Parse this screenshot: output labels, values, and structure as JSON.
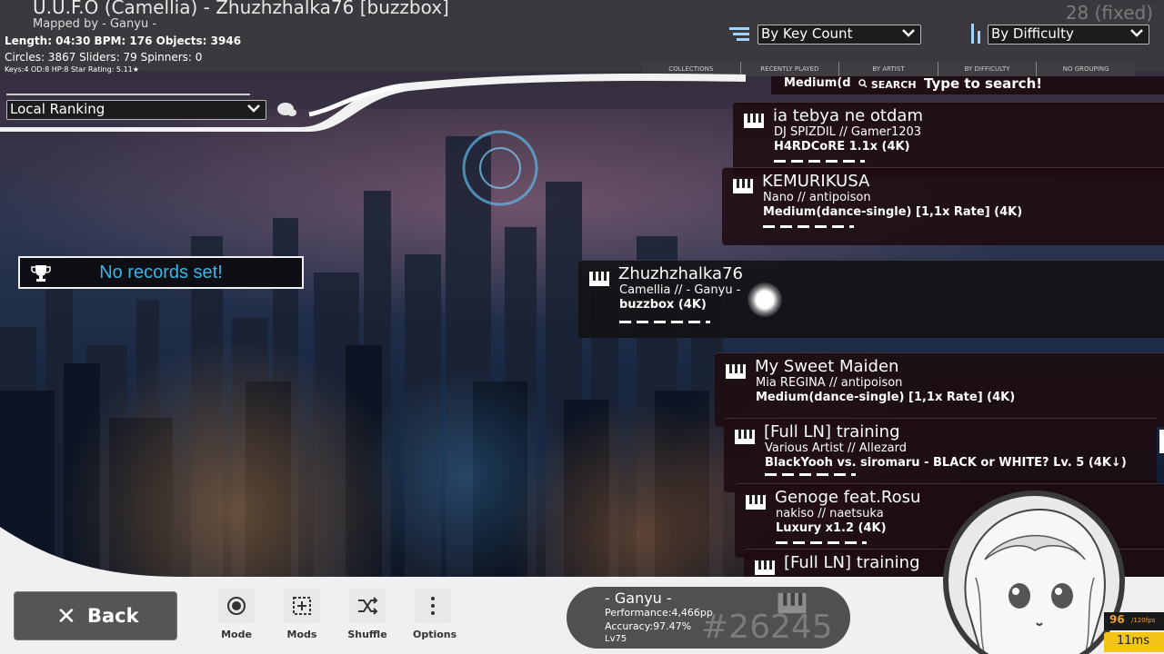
{
  "header": {
    "song_title": "U.U.F.O (Camellia) - Zhuzhzhalka76 [buzzbox]",
    "mapped_by": "Mapped by - Ganyu -",
    "stats_line1": "Length: 04:30 BPM: 176 Objects: 3946",
    "stats_line2": "Circles: 3867 Sliders: 79 Spinners: 0",
    "stats_line3": "Keys:4 OD:8 HP:8 Star Rating: 5.11★",
    "fixed_count": "28 (fixed)"
  },
  "sort": {
    "sort_label": "By Key Count",
    "group_label": "By Difficulty"
  },
  "group_tabs": [
    "COLLECTIONS",
    "RECENTLY PLAYED",
    "BY ARTIST",
    "BY DIFFICULTY",
    "NO GROUPING"
  ],
  "search": {
    "partial_diff": "Medium(d",
    "label": "SEARCH",
    "placeholder": "Type to search!"
  },
  "ranking": {
    "dropdown_label": "Local Ranking",
    "no_records": "No records set!"
  },
  "songs": [
    {
      "title": "ia tebya ne otdam",
      "artist": "DJ SPIZDIL // Gamer1203",
      "diff": "H4RDCoRE 1.1x (4K)"
    },
    {
      "title": "KEMURIKUSA",
      "artist": "Nano // antipoison",
      "diff": "Medium(dance-single) [1,1x Rate] (4K)"
    },
    {
      "title": "Zhuzhzhalka76",
      "artist": "Camellia // - Ganyu -",
      "diff": "buzzbox (4K)"
    },
    {
      "title": "My Sweet Maiden",
      "artist": "Mia REGINA // antipoison",
      "diff": "Medium(dance-single) [1,1x Rate] (4K)"
    },
    {
      "title": "[Full LN] training",
      "artist": "Various Artist // Allezard",
      "diff": "BlackYooh vs. siromaru - BLACK or WHITE? Lv. 5 (4K↓)"
    },
    {
      "title": "Genoge feat.Rosu",
      "artist": "nakiso // naetsuka",
      "diff": "Luxury x1.2 (4K)"
    },
    {
      "title": "[Full LN] training",
      "artist": "",
      "diff": ""
    }
  ],
  "toolbar": {
    "back_label": "Back",
    "mode_label": "Mode",
    "mods_label": "Mods",
    "shuffle_label": "Shuffle",
    "options_label": "Options"
  },
  "profile": {
    "name": "- Ganyu -",
    "performance": "Performance:4,466pp",
    "accuracy": "Accuracy:97.47%",
    "level": "Lv75",
    "rank": "#26245"
  },
  "perf": {
    "fps": "96",
    "fps_unit": "/120fps",
    "latency": "11ms"
  },
  "colors": {
    "accent_blue": "#39b6e8",
    "card_bg": "#1e0c12",
    "latency_badge": "#f2c418"
  }
}
